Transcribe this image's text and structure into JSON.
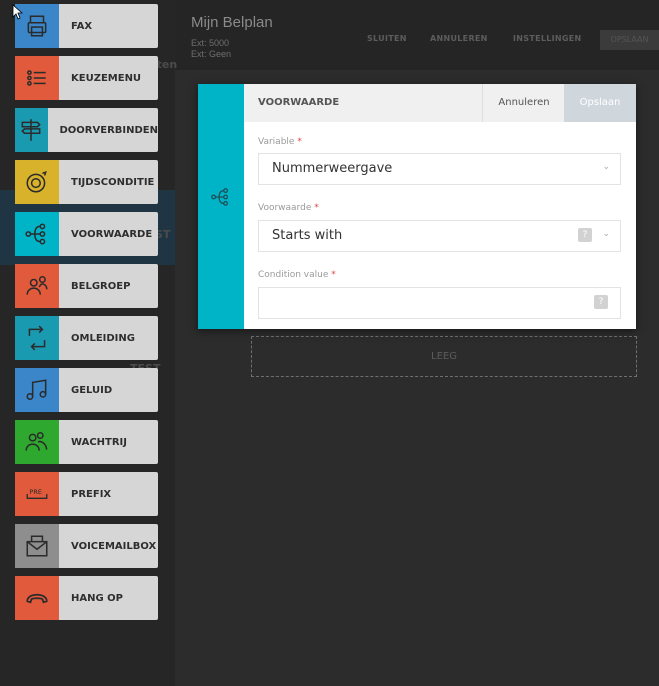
{
  "header": {
    "title": "Mijn Belplan",
    "ext_line": "Ext: 5000",
    "ext2_line": "Ext: Geen",
    "links": [
      "SLUITEN",
      "ANNULEREN",
      "INSTELLINGEN"
    ],
    "right_button": "OPSLAAN"
  },
  "background": {
    "labels": [
      "Wachtlijsten",
      "TEST",
      "TEST"
    ],
    "empty_slot": "LEEG"
  },
  "menu": [
    {
      "label": "FAX",
      "color": "#3a86c9",
      "icon": "fax-icon"
    },
    {
      "label": "KEUZEMENU",
      "color": "#e05a3b",
      "icon": "menu-list-icon"
    },
    {
      "label": "DOORVERBINDEN",
      "color": "#1a9ab0",
      "icon": "signpost-icon"
    },
    {
      "label": "TIJDSCONDITIE",
      "color": "#d9b22c",
      "icon": "clock-icon"
    },
    {
      "label": "VOORWAARDE",
      "color": "#00b4c7",
      "icon": "branch-icon"
    },
    {
      "label": "BELGROEP",
      "color": "#e05a3b",
      "icon": "group-icon"
    },
    {
      "label": "OMLEIDING",
      "color": "#1a9ab0",
      "icon": "redirect-icon"
    },
    {
      "label": "GELUID",
      "color": "#3a86c9",
      "icon": "music-note-icon"
    },
    {
      "label": "WACHTRIJ",
      "color": "#2ea82e",
      "icon": "queue-icon"
    },
    {
      "label": "PREFIX",
      "color": "#e05a3b",
      "icon": "prefix-icon"
    },
    {
      "label": "VOICEMAILBOX",
      "color": "#8e8e8e",
      "icon": "envelope-icon"
    },
    {
      "label": "HANG OP",
      "color": "#e05a3b",
      "icon": "hang-up-icon"
    }
  ],
  "dialog": {
    "title": "VOORWAARDE",
    "cancel": "Annuleren",
    "save": "Opslaan",
    "accent": "#00b4c7",
    "fields": {
      "variable_label": "Variable",
      "variable_value": "Nummerweergave",
      "condition_label": "Voorwaarde",
      "condition_value": "Starts with",
      "value_label": "Condition value",
      "value_value": "",
      "required_mark": "*",
      "help_mark": "?",
      "caret": "⌄"
    }
  }
}
